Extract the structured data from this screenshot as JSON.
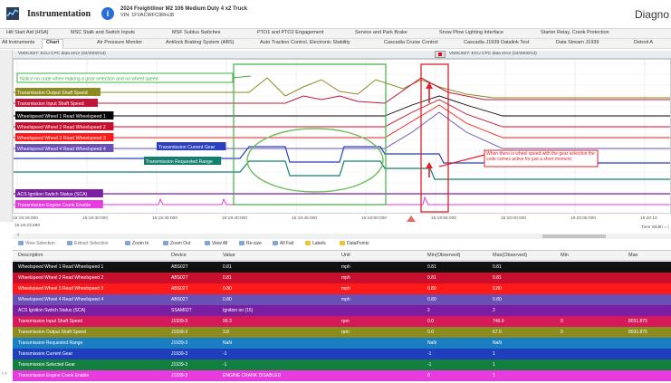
{
  "app": {
    "title": "Instrumentation",
    "vehicle_line1": "2024 Freightliner M2 106 Medium Duty 4 x2 Truck",
    "vehicle_line2": "VIN: 1FVACWFC9RHJ8",
    "right_title": "Diagno"
  },
  "tabs_row1": [
    "Hill Start Aid (HSA)",
    "MSC Stalk and Switch Inputs",
    "MSF Sublus Switches",
    "PTO1 and PTO2 Engagement",
    "Service and Park Brake",
    "Snow Plow Lighting Interface",
    "Starter Relay, Crank Protection"
  ],
  "tabs_row2": [
    "All Instruments",
    "Chart",
    "Air Pressure Monitor",
    "Antilock Braking System (ABS)",
    "Auto Traction Control, Electronic Stability",
    "Cascadia Cruise Control",
    "Cascadia J1939 Datalink Test",
    "Data Stream J1939",
    "Detroit A"
  ],
  "chart_header": {
    "left": "VMSU027: ECU CPC data error (32/4000/13)",
    "right": "VMSU027: ECU CPC data error (32/4000/13)"
  },
  "annotations": {
    "top_note": "Notice no code when making a gear selection and no wheel speed",
    "red_note": "When there is wheel speed with the gear selection the code comes active for just a short moment"
  },
  "chart_data": {
    "type": "line",
    "xlabel": "",
    "ylabel": "",
    "x_ticks": [
      "15:19:25:000",
      "15:19:30:000",
      "15:19:35:000",
      "15:19:40:000",
      "15:19:45:000",
      "15:19:50:000",
      "15:19:55:000",
      "15:20:00:000",
      "15:20:05:000",
      "15:20:10"
    ],
    "x_start_label": "15:19:23.690",
    "time_width_label": "Time Width = (",
    "channel_labels": [
      {
        "name": "Transmission Output Shaft Speed",
        "color": "#8b8b1f"
      },
      {
        "name": "Transmission Input Shaft Speed",
        "color": "#c0143c"
      },
      {
        "name": "Wheelspeed Wheel 1 Read Wheelspeed 1",
        "color": "#000000"
      },
      {
        "name": "Wheelspeed Wheel 2 Read Wheelspeed 2",
        "color": "#c8102e"
      },
      {
        "name": "Wheelspeed Wheel 3 Read Wheelspeed 3",
        "color": "#ff1a1a"
      },
      {
        "name": "Wheelspeed Wheel 4 Read Wheelspeed 4",
        "color": "#6a4fb5"
      },
      {
        "name": "Transmission Current Gear",
        "color": "#2a3fbf"
      },
      {
        "name": "Transmission Requested Range",
        "color": "#137f6e"
      },
      {
        "name": "ACS Ignition Switch Status (SCA)",
        "color": "#7a1fa2"
      },
      {
        "name": "Transmission Engine Crank Enable",
        "color": "#e83adf"
      }
    ]
  },
  "toolbar": {
    "view_selection": "View Selection",
    "extract_selection": "Extract Selection",
    "zoom_in": "Zoom In",
    "zoom_out": "Zoom Out",
    "view_all": "View All",
    "re_size": "Re-size",
    "all_fail": "All Fail",
    "labels": "Labels",
    "data_points": "DataPoints"
  },
  "table": {
    "headers": [
      "Description",
      "Device",
      "Value",
      "Unit",
      "Min(Observed)",
      "Max(Observed)",
      "Min",
      "Max"
    ],
    "rows": [
      {
        "desc": "Wheelspeed Wheel 1 Read Wheelspeed 1",
        "device": "ABS02T",
        "value": "0.81",
        "unit": "mph",
        "min_obs": "0.81",
        "max_obs": "0.81",
        "min": "",
        "max": "",
        "color": "#111111"
      },
      {
        "desc": "Wheelspeed Wheel 2 Read Wheelspeed 2",
        "device": "ABS02T",
        "value": "0.81",
        "unit": "mph",
        "min_obs": "0.81",
        "max_obs": "0.81",
        "min": "",
        "max": "",
        "color": "#c8102e"
      },
      {
        "desc": "Wheelspeed Wheel 3 Read Wheelspeed 3",
        "device": "ABS02T",
        "value": "0.80",
        "unit": "mph",
        "min_obs": "0.80",
        "max_obs": "0.80",
        "min": "",
        "max": "",
        "color": "#ff1a1a"
      },
      {
        "desc": "Wheelspeed Wheel 4 Read Wheelspeed 4",
        "device": "ABS02T",
        "value": "0.80",
        "unit": "mph",
        "min_obs": "0.80",
        "max_obs": "0.80",
        "min": "",
        "max": "",
        "color": "#6a4fb5"
      },
      {
        "desc": "ACS Ignition Switch Status (SCA)",
        "device": "SSAM02T",
        "value": "Ignition on (15)",
        "unit": "",
        "min_obs": "2",
        "max_obs": "2",
        "min": "",
        "max": "",
        "color": "#7a1fa2"
      },
      {
        "desc": "Transmission Input Shaft Speed",
        "device": "J1939-3",
        "value": "99.3",
        "unit": "rpm",
        "min_obs": "0.0",
        "max_obs": "746.9",
        "min": "0",
        "max": "8031.875",
        "color": "#d6195a"
      },
      {
        "desc": "Transmission Output Shaft Speed",
        "device": "J1939-3",
        "value": "3.8",
        "unit": "rpm",
        "min_obs": "0.0",
        "max_obs": "67.9",
        "min": "0",
        "max": "8031.875",
        "color": "#8b8b1f"
      },
      {
        "desc": "Transmission Requested Range",
        "device": "J1939-3",
        "value": "NaN",
        "unit": "",
        "min_obs": "NaN",
        "max_obs": "NaN",
        "min": "",
        "max": "",
        "color": "#1a7fc0"
      },
      {
        "desc": "Transmission Current Gear",
        "device": "J1939-3",
        "value": "-1",
        "unit": "",
        "min_obs": "-1",
        "max_obs": "1",
        "min": "",
        "max": "",
        "color": "#1f3fbf"
      },
      {
        "desc": "Transmission Selected Gear",
        "device": "J1939-3",
        "value": "-1",
        "unit": "",
        "min_obs": "-1",
        "max_obs": "1",
        "min": "",
        "max": "",
        "color": "#137f3e"
      },
      {
        "desc": "Transmission Engine Crank Enable",
        "device": "J1939-3",
        "value": "ENGINE CRANK DISABLED",
        "unit": "",
        "min_obs": "0",
        "max_obs": "1",
        "min": "",
        "max": "",
        "color": "#e83adf"
      }
    ]
  }
}
